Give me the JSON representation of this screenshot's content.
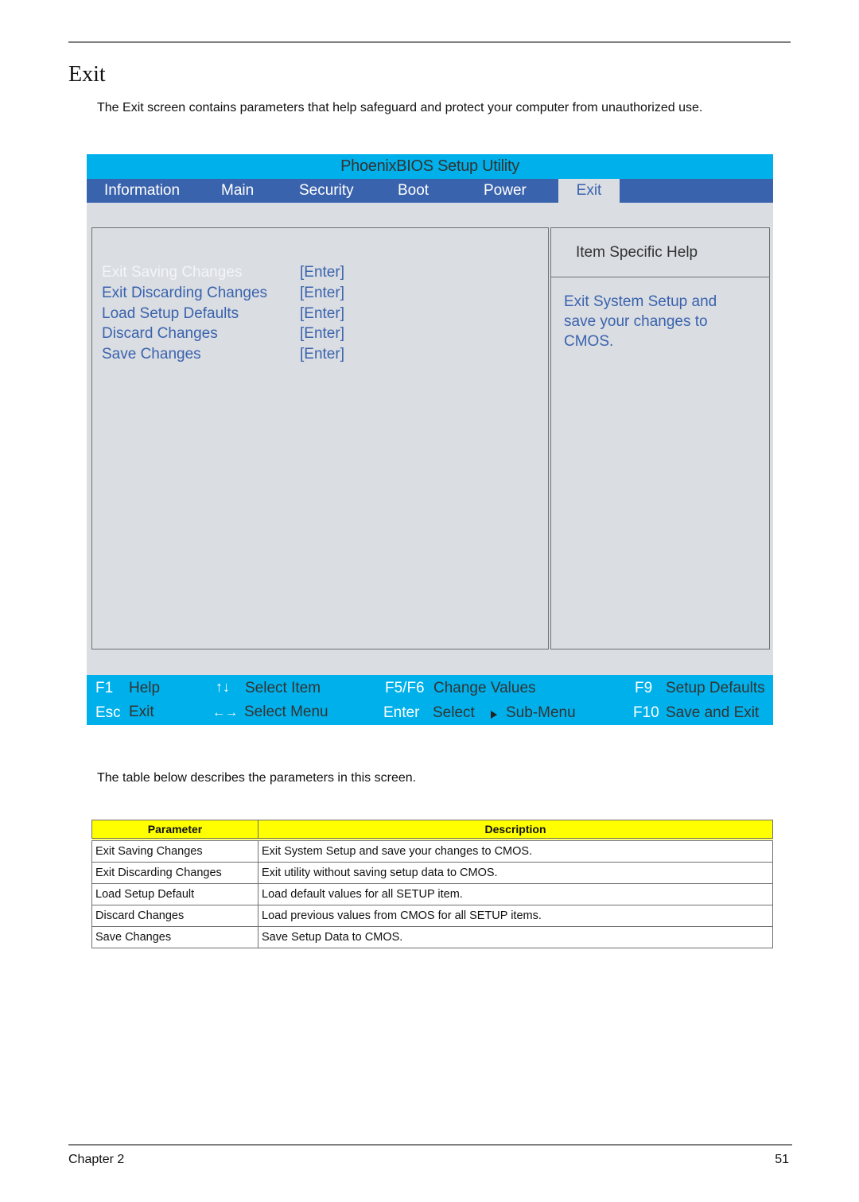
{
  "page": {
    "title": "Exit",
    "intro": "The Exit screen contains parameters that help safeguard and protect your computer from unauthorized use.",
    "table_intro": "The table below describes the parameters in this screen.",
    "footer": {
      "chapter": "Chapter 2",
      "page_number": "51"
    }
  },
  "bios": {
    "title": "PhoenixBIOS Setup Utility",
    "tabs": [
      {
        "label": "Information",
        "active": false
      },
      {
        "label": "Main",
        "active": false
      },
      {
        "label": "Security",
        "active": false
      },
      {
        "label": "Boot",
        "active": false
      },
      {
        "label": "Power",
        "active": false
      },
      {
        "label": "Exit",
        "active": true
      }
    ],
    "items": [
      {
        "label": "Exit Saving Changes",
        "value": "[Enter]",
        "selected": true
      },
      {
        "label": "Exit Discarding Changes",
        "value": "[Enter]",
        "selected": false
      },
      {
        "label": "Load Setup Defaults",
        "value": "[Enter]",
        "selected": false
      },
      {
        "label": "Discard Changes",
        "value": "[Enter]",
        "selected": false
      },
      {
        "label": "Save Changes",
        "value": "[Enter]",
        "selected": false
      }
    ],
    "help": {
      "title": "Item Specific Help",
      "text": "Exit System Setup and save your changes to CMOS."
    },
    "keys": {
      "f1": {
        "key": "F1",
        "desc": "Help"
      },
      "esc": {
        "key": "Esc",
        "desc": "Exit"
      },
      "updown": {
        "icon": "up-down-arrows-icon",
        "glyph": "↑↓",
        "desc": "Select Item"
      },
      "leftright": {
        "icon": "left-right-arrows-icon",
        "glyph": "←→",
        "desc": "Select Menu"
      },
      "f5f6": {
        "key": "F5/F6",
        "desc": "Change Values"
      },
      "enter": {
        "key": "Enter",
        "desc": "Select",
        "submenu": "Sub-Menu"
      },
      "f9": {
        "key": "F9",
        "desc": "Setup Defaults"
      },
      "f10": {
        "key": "F10",
        "desc": "Save and Exit"
      }
    },
    "colors": {
      "title_bar": "#00b0ea",
      "menu_bar": "#3a63ad",
      "body": "#dadde2",
      "item_text": "#3a63ad",
      "selected_text": "#f4f5f7"
    }
  },
  "table": {
    "headers": [
      "Parameter",
      "Description"
    ],
    "header_color": "#ffff00",
    "rows": [
      [
        "Exit Saving Changes",
        "Exit System Setup and save your changes to CMOS."
      ],
      [
        "Exit Discarding Changes",
        "Exit utility without saving setup data to CMOS."
      ],
      [
        "Load Setup Default",
        "Load default values for all SETUP item."
      ],
      [
        "Discard Changes",
        "Load previous values from CMOS for all SETUP items."
      ],
      [
        "Save Changes",
        "Save Setup Data to CMOS."
      ]
    ]
  }
}
